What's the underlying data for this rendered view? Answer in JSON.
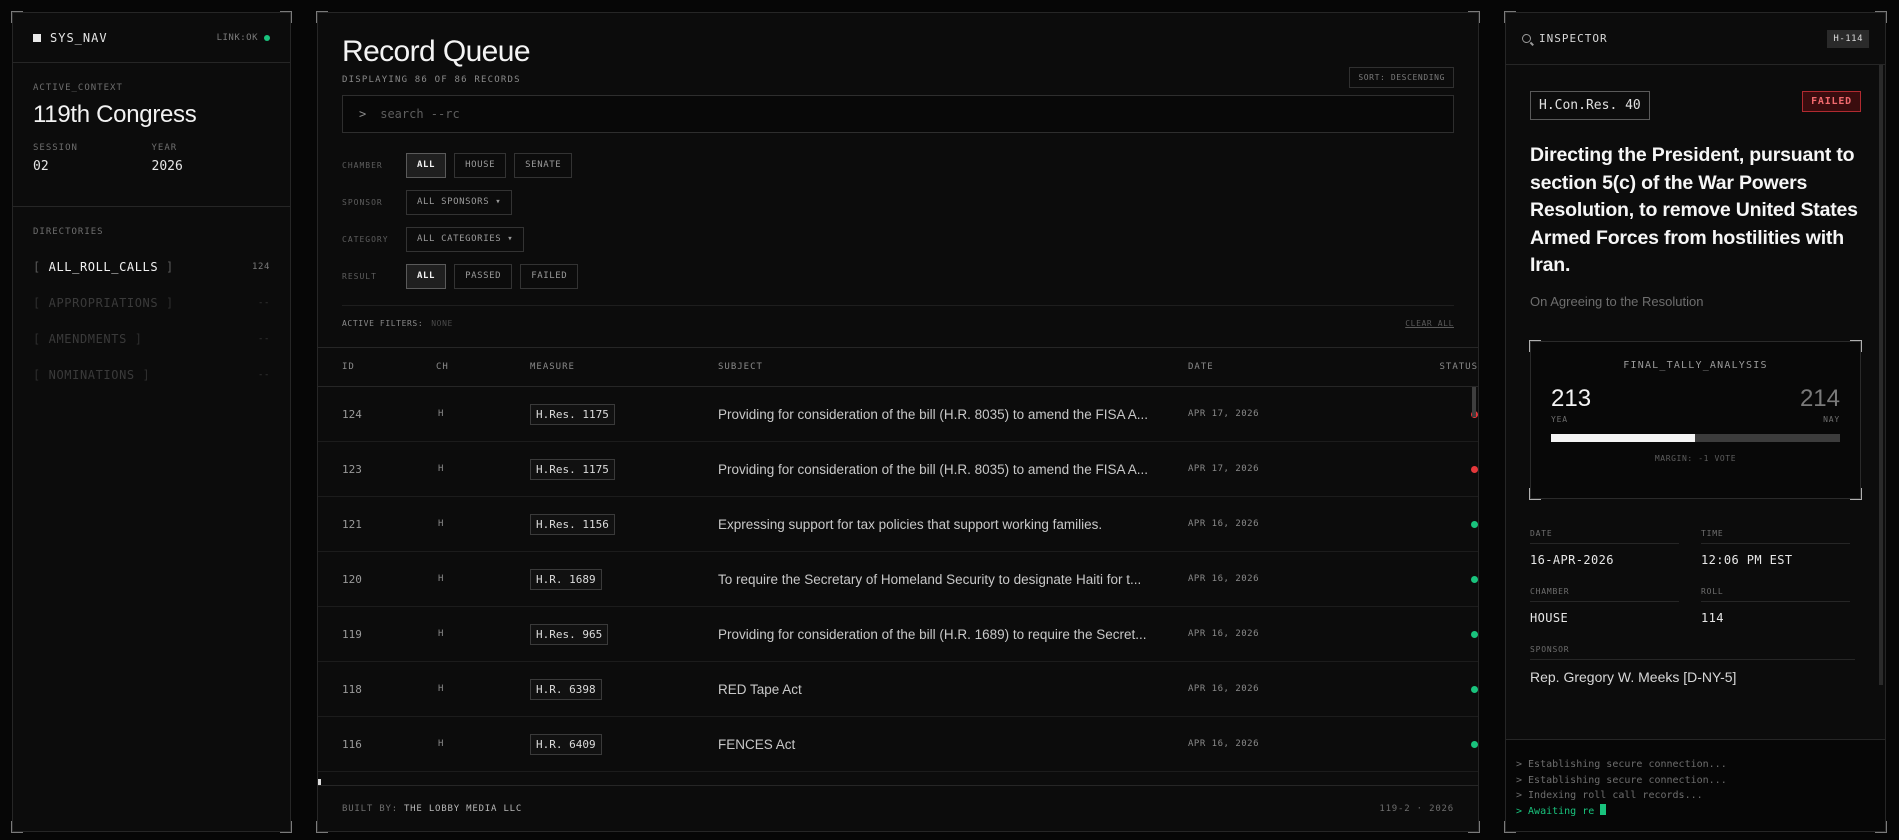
{
  "nav": {
    "title": "SYS_NAV",
    "link_status": "LINK:OK",
    "context_label": "ACTIVE_CONTEXT",
    "congress": "119th Congress",
    "session_label": "SESSION",
    "session": "02",
    "year_label": "YEAR",
    "year": "2026",
    "directories_label": "DIRECTORIES",
    "directories": [
      {
        "name": "ALL_ROLL_CALLS",
        "count": "124",
        "active": true
      },
      {
        "name": "APPROPRIATIONS",
        "count": "--",
        "active": false
      },
      {
        "name": "AMENDMENTS",
        "count": "--",
        "active": false
      },
      {
        "name": "NOMINATIONS",
        "count": "--",
        "active": false
      }
    ]
  },
  "main": {
    "title": "Record Queue",
    "subtitle": "DISPLAYING 86 OF 86 RECORDS",
    "sort": "SORT: DESCENDING",
    "search_prompt": ">",
    "search_placeholder": "search --rc",
    "filters": {
      "chamber_label": "CHAMBER",
      "chamber_options": [
        "ALL",
        "HOUSE",
        "SENATE"
      ],
      "sponsor_label": "SPONSOR",
      "sponsor_value": "ALL SPONSORS ▾",
      "category_label": "CATEGORY",
      "category_value": "ALL CATEGORIES ▾",
      "result_label": "RESULT",
      "result_options": [
        "ALL",
        "PASSED",
        "FAILED"
      ]
    },
    "active_filters_label": "ACTIVE FILTERS:",
    "active_filters_value": "NONE",
    "clear_all": "CLEAR ALL",
    "columns": [
      "ID",
      "CH",
      "MEASURE",
      "SUBJECT",
      "DATE",
      "STATUS"
    ],
    "rows": [
      {
        "id": "124",
        "ch": "H",
        "measure": "H.Res. 1175",
        "subject": "Providing for consideration of the bill (H.R. 8035) to amend the FISA A...",
        "date": "APR 17, 2026",
        "status": "failed"
      },
      {
        "id": "123",
        "ch": "H",
        "measure": "H.Res. 1175",
        "subject": "Providing for consideration of the bill (H.R. 8035) to amend the FISA A...",
        "date": "APR 17, 2026",
        "status": "failed"
      },
      {
        "id": "121",
        "ch": "H",
        "measure": "H.Res. 1156",
        "subject": "Expressing support for tax policies that support working families.",
        "date": "APR 16, 2026",
        "status": "passed"
      },
      {
        "id": "120",
        "ch": "H",
        "measure": "H.R. 1689",
        "subject": "To require the Secretary of Homeland Security to designate Haiti for t...",
        "date": "APR 16, 2026",
        "status": "passed"
      },
      {
        "id": "119",
        "ch": "H",
        "measure": "H.Res. 965",
        "subject": "Providing for consideration of the bill (H.R. 1689) to require the Secret...",
        "date": "APR 16, 2026",
        "status": "passed"
      },
      {
        "id": "118",
        "ch": "H",
        "measure": "H.R. 6398",
        "subject": "RED Tape Act",
        "date": "APR 16, 2026",
        "status": "passed"
      },
      {
        "id": "116",
        "ch": "H",
        "measure": "H.R. 6409",
        "subject": "FENCES Act",
        "date": "APR 16, 2026",
        "status": "passed"
      }
    ],
    "footer_built_by": "BUILT BY:",
    "footer_builder": "THE LOBBY MEDIA LLC",
    "footer_version": "119-2 · 2026"
  },
  "inspector": {
    "title": "INSPECTOR",
    "record_tag": "H-114",
    "measure": "H.Con.Res. 40",
    "status": "FAILED",
    "headline": "Directing the President, pursuant to section 5(c) of the War Powers Resolution, to remove United States Armed Forces from hostilities with Iran.",
    "question": "On Agreeing to the Resolution",
    "tally_title": "FINAL_TALLY_ANALYSIS",
    "yea": "213",
    "nay": "214",
    "yea_label": "YEA",
    "nay_label": "NAY",
    "yea_share": 0.4988,
    "margin": "MARGIN: -1 VOTE",
    "date_label": "DATE",
    "date": "16-APR-2026",
    "time_label": "TIME",
    "time": "12:06 PM EST",
    "chamber_label": "CHAMBER",
    "chamber": "HOUSE",
    "roll_label": "ROLL",
    "roll": "114",
    "sponsor_label": "SPONSOR",
    "sponsor": "Rep. Gregory W. Meeks [D-NY-5]",
    "console": [
      "> Establishing secure connection...",
      "> Establishing secure connection...",
      "> Indexing roll call records...",
      "> Awaiting re"
    ]
  },
  "colors": {
    "passed": "#19c37d",
    "failed": "#e5383b",
    "accent": "#f4f4f4"
  }
}
